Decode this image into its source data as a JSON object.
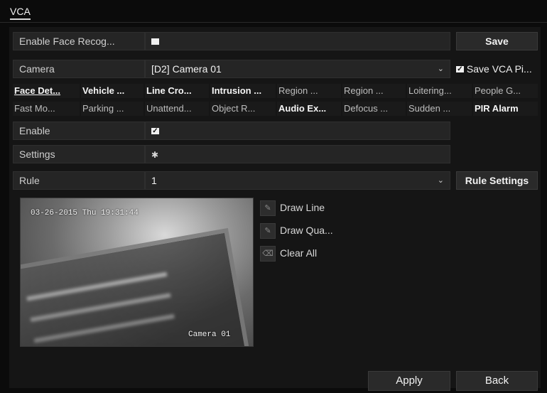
{
  "tab": {
    "title": "VCA"
  },
  "rows": {
    "face_recog": {
      "label": "Enable Face Recog...",
      "checked": true,
      "save_label": "Save"
    },
    "camera": {
      "label": "Camera",
      "value": "[D2] Camera 01",
      "save_vca_label": "Save VCA Pi...",
      "save_vca_checked": true
    },
    "enable": {
      "label": "Enable",
      "checked": true
    },
    "settings": {
      "label": "Settings",
      "icon": "gear-icon"
    },
    "rule": {
      "label": "Rule",
      "value": "1",
      "settings_label": "Rule Settings"
    }
  },
  "detection_tabs": [
    {
      "label": "Face Det...",
      "active": true
    },
    {
      "label": "Vehicle ..."
    },
    {
      "label": "Line Cro..."
    },
    {
      "label": "Intrusion ..."
    },
    {
      "label": "Region ..."
    },
    {
      "label": "Region ..."
    },
    {
      "label": "Loitering..."
    },
    {
      "label": "People G..."
    },
    {
      "label": "Fast Mo..."
    },
    {
      "label": "Parking ..."
    },
    {
      "label": "Unattend..."
    },
    {
      "label": "Object R..."
    },
    {
      "label": "Audio Ex..."
    },
    {
      "label": "Defocus ..."
    },
    {
      "label": "Sudden ..."
    },
    {
      "label": "PIR Alarm"
    }
  ],
  "video": {
    "timestamp": "03-26-2015 Thu 19:31:44",
    "camera_name": "Camera 01"
  },
  "tools": {
    "draw_line": "Draw Line",
    "draw_quad": "Draw Qua...",
    "clear_all": "Clear All"
  },
  "footer": {
    "apply": "Apply",
    "back": "Back"
  }
}
